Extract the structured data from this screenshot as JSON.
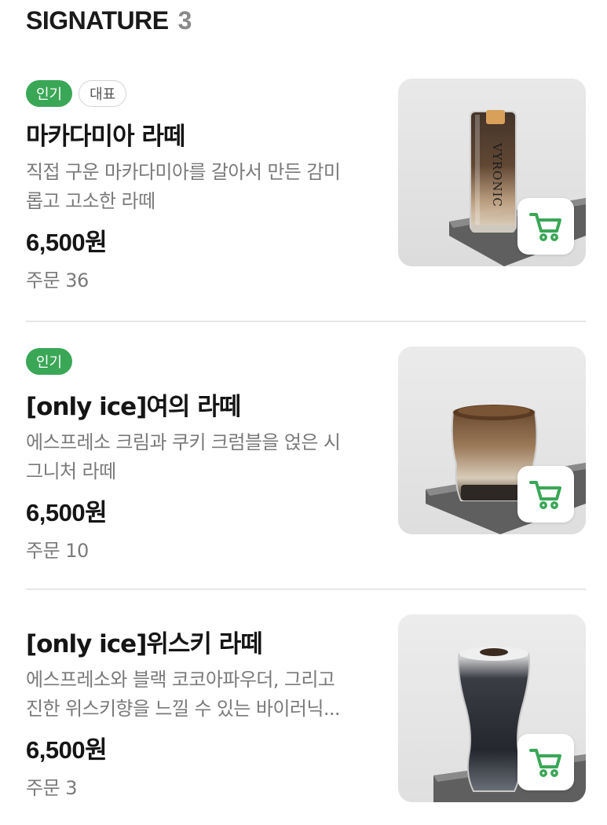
{
  "section": {
    "title": "SIGNATURE",
    "count": "3"
  },
  "items": [
    {
      "badges": [
        "인기",
        "대표"
      ],
      "name": "마카다미아 라떼",
      "desc_line1": "직접 구운 마카다미아를 갈아서 만든 감미",
      "desc_line2": "롭고 고소한 라떼",
      "price": "6,500원",
      "orders": "주문 36",
      "cup_print": "VYRONIC"
    },
    {
      "badges": [
        "인기"
      ],
      "name": "[only ice]여의 라떼",
      "desc_line1": "에스프레소 크림과 쿠키 크럼블을 얹은 시",
      "desc_line2": "그니처 라떼",
      "price": "6,500원",
      "orders": "주문 10"
    },
    {
      "badges": [],
      "name": "[only ice]위스키 라떼",
      "desc_line1": "에스프레소와 블랙 코코아파우더, 그리고",
      "desc_line2": "진한 위스키향을 느낄 수 있는 바이러닉...",
      "price": "6,500원",
      "orders": "주문 3"
    }
  ],
  "colors": {
    "accent_green": "#3aa757",
    "cart_green": "#3aa757",
    "text_primary": "#151515",
    "text_secondary": "#7a7a7a"
  },
  "icons": {
    "cart": "cart-icon"
  }
}
